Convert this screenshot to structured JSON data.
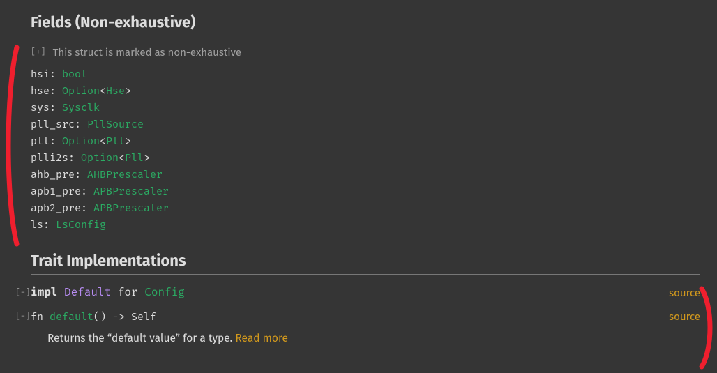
{
  "sections": {
    "fields_header": "Fields (Non-exhaustive)",
    "trait_impl_header": "Trait Implementations"
  },
  "non_exhaustive": {
    "expander": "[+]",
    "text": "This struct is marked as non-exhaustive"
  },
  "fields": [
    {
      "name": "hsi",
      "type_tokens": [
        {
          "t": "prim",
          "v": "bool"
        }
      ]
    },
    {
      "name": "hse",
      "type_tokens": [
        {
          "t": "type",
          "v": "Option"
        },
        {
          "t": "angle",
          "v": "<"
        },
        {
          "t": "type",
          "v": "Hse"
        },
        {
          "t": "angle",
          "v": ">"
        }
      ]
    },
    {
      "name": "sys",
      "type_tokens": [
        {
          "t": "type",
          "v": "Sysclk"
        }
      ]
    },
    {
      "name": "pll_src",
      "type_tokens": [
        {
          "t": "type",
          "v": "PllSource"
        }
      ]
    },
    {
      "name": "pll",
      "type_tokens": [
        {
          "t": "type",
          "v": "Option"
        },
        {
          "t": "angle",
          "v": "<"
        },
        {
          "t": "type",
          "v": "Pll"
        },
        {
          "t": "angle",
          "v": ">"
        }
      ]
    },
    {
      "name": "plli2s",
      "type_tokens": [
        {
          "t": "type",
          "v": "Option"
        },
        {
          "t": "angle",
          "v": "<"
        },
        {
          "t": "type",
          "v": "Pll"
        },
        {
          "t": "angle",
          "v": ">"
        }
      ]
    },
    {
      "name": "ahb_pre",
      "type_tokens": [
        {
          "t": "type",
          "v": "AHBPrescaler"
        }
      ]
    },
    {
      "name": "apb1_pre",
      "type_tokens": [
        {
          "t": "type",
          "v": "APBPrescaler"
        }
      ]
    },
    {
      "name": "apb2_pre",
      "type_tokens": [
        {
          "t": "type",
          "v": "APBPrescaler"
        }
      ]
    },
    {
      "name": "ls",
      "type_tokens": [
        {
          "t": "type",
          "v": "LsConfig"
        }
      ]
    }
  ],
  "impl": {
    "toggle": "[−]",
    "kw_impl": "impl",
    "trait": "Default",
    "kw_for": "for",
    "type": "Config",
    "source": "source"
  },
  "fn": {
    "toggle": "[−]",
    "kw_fn": "fn",
    "name": "default",
    "sig_rest": "() -> Self",
    "source": "source",
    "doc": "Returns the “default value” for a type. ",
    "read_more": "Read more"
  },
  "colors": {
    "accent_type": "#2bab63",
    "accent_trait": "#b78cf2",
    "accent_link": "#d2991d",
    "annotation": "#ef1f2e"
  }
}
